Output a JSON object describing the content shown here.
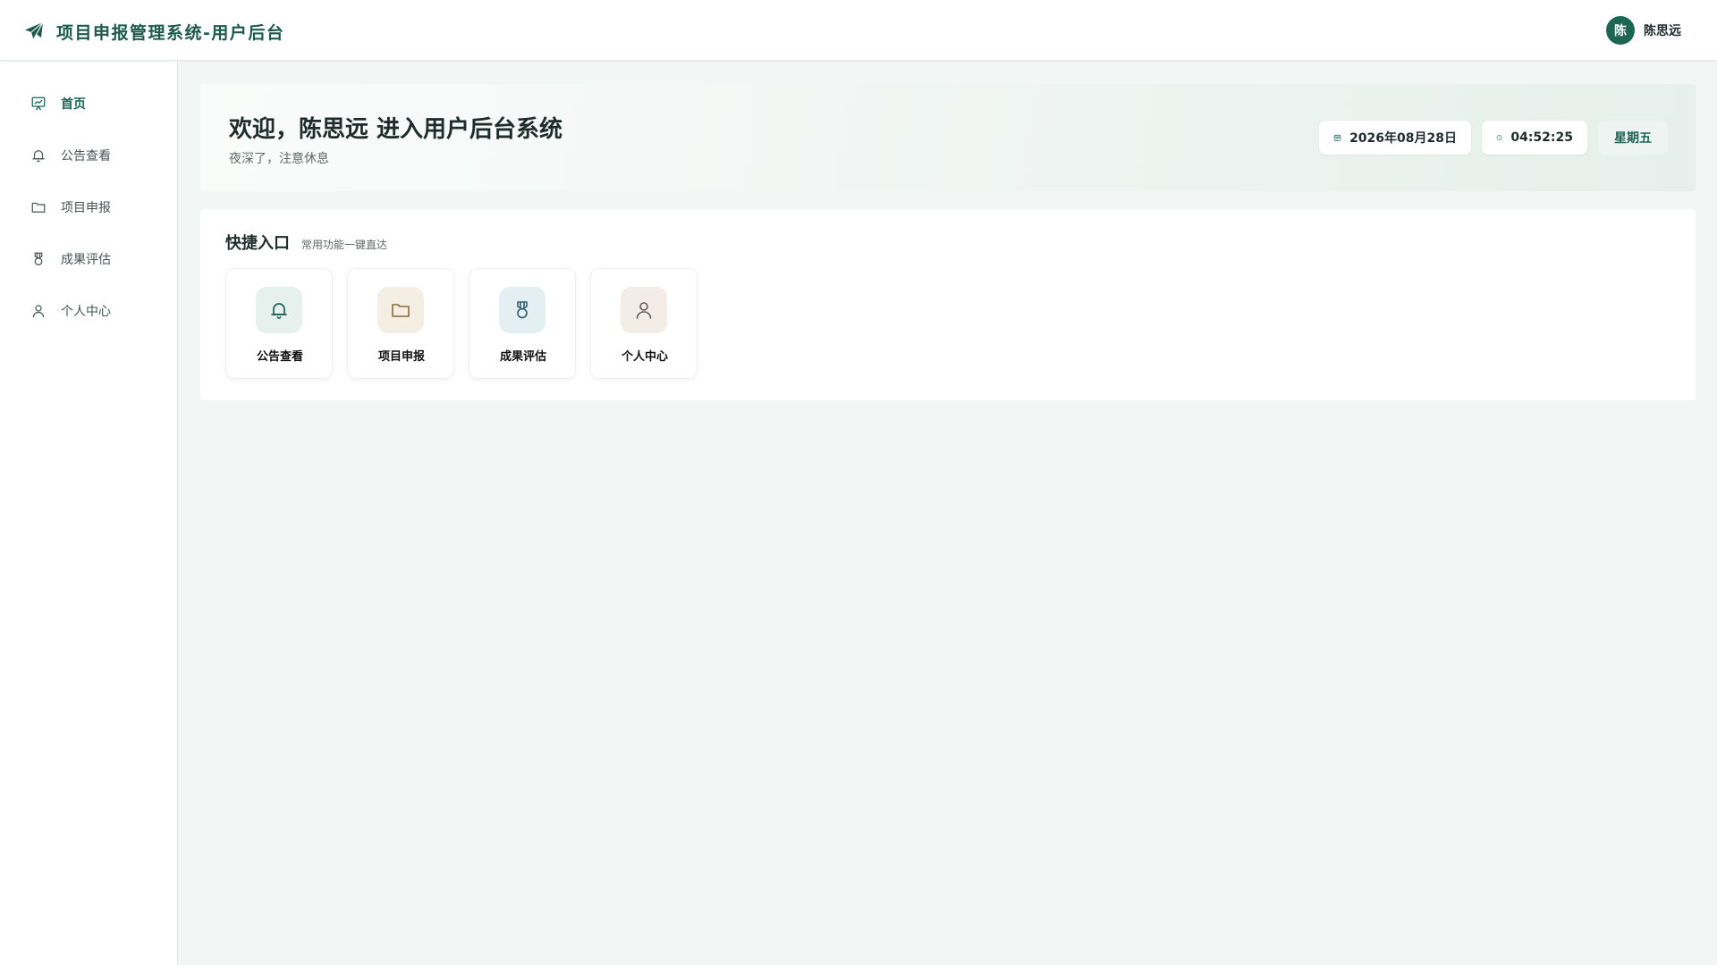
{
  "header": {
    "title": "项目申报管理系统-用户后台",
    "logo_icon": "paper-plane-icon",
    "user": {
      "avatar_text": "陈",
      "name": "陈思远"
    }
  },
  "sidebar": {
    "items": [
      {
        "label": "首页",
        "icon": "presentation-chart-icon",
        "active": true
      },
      {
        "label": "公告查看",
        "icon": "bell-icon",
        "active": false
      },
      {
        "label": "项目申报",
        "icon": "folder-icon",
        "active": false
      },
      {
        "label": "成果评估",
        "icon": "medal-icon",
        "active": false
      },
      {
        "label": "个人中心",
        "icon": "user-icon",
        "active": false
      }
    ]
  },
  "welcome": {
    "title": "欢迎，陈思远 进入用户后台系统",
    "subtitle": "夜深了，注意休息",
    "date": "2026年08月28日",
    "time": "04:52:25",
    "weekday": "星期五"
  },
  "quick": {
    "title": "快捷入口",
    "subtitle": "常用功能一键直达",
    "items": [
      {
        "label": "公告查看",
        "icon": "bell-icon"
      },
      {
        "label": "项目申报",
        "icon": "folder-icon"
      },
      {
        "label": "成果评估",
        "icon": "medal-icon"
      },
      {
        "label": "个人中心",
        "icon": "user-icon"
      }
    ]
  },
  "colors": {
    "primary": "#1d6654",
    "brand_text": "#1d5a4c",
    "background": "#f2f6f4",
    "quick_icon_bg_1": "#e6f1ed",
    "quick_icon_bg_2": "#f5efe3",
    "quick_icon_bg_3": "#e4eff2",
    "quick_icon_bg_4": "#f3ece7"
  }
}
